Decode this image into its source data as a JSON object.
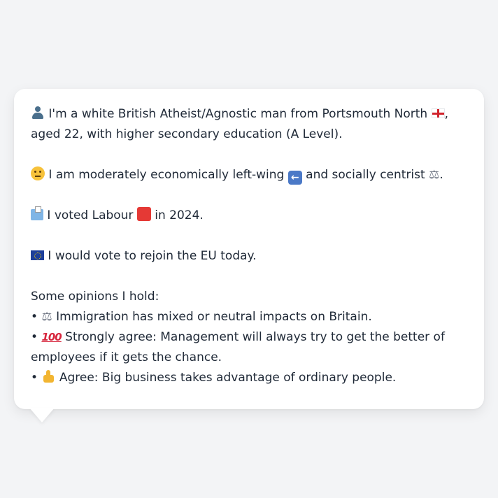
{
  "profile": {
    "line1": {
      "icon": "person-silhouette-icon",
      "text_a": "I'm a white British Atheist/Agnostic man from Portsmouth North",
      "flag_icon": "england-flag-icon",
      "text_b": ", aged 22, with higher secondary education (A Level)."
    },
    "line2": {
      "icon": "thinking-face-icon",
      "text_a": "I am moderately economically left-wing",
      "arrow_icon": "left-arrow-icon",
      "arrow_glyph": "←",
      "text_b": "and socially centrist",
      "scales_icon": "balance-scale-icon",
      "scales_glyph": "⚖",
      "text_c": "."
    },
    "line3": {
      "icon": "ballot-box-icon",
      "text_a": "I voted Labour",
      "square_icon": "red-square-icon",
      "text_b": "in 2024."
    },
    "line4": {
      "icon": "eu-flag-icon",
      "text": "I would vote to rejoin the EU today."
    },
    "opinions": {
      "heading": "Some opinions I hold:",
      "bullet": "•",
      "items": [
        {
          "icon": "balance-scale-icon",
          "glyph": "⚖",
          "text": "Immigration has mixed or neutral impacts on Britain."
        },
        {
          "icon": "hundred-points-icon",
          "glyph": "100",
          "text": "Strongly agree: Management will always try to get the better of employees if it gets the chance."
        },
        {
          "icon": "thumbs-up-icon",
          "text": "Agree: Big business takes advantage of ordinary people."
        }
      ]
    }
  },
  "colors": {
    "page_background": "#f3f4f6",
    "bubble_background": "#ffffff",
    "text": "#1f2937"
  }
}
